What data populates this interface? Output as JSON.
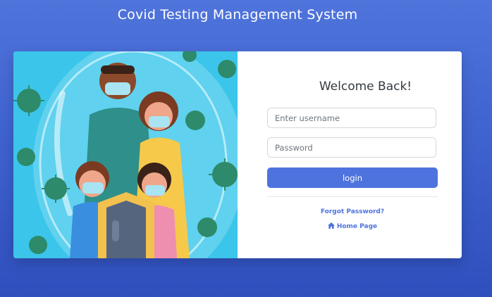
{
  "header": {
    "title": "Covid Testing Management System"
  },
  "login": {
    "heading": "Welcome Back!",
    "username_placeholder": "Enter username",
    "password_placeholder": "Password",
    "button_label": "login",
    "forgot_label": "Forgot Password?",
    "home_label": "Home Page",
    "home_icon": "home-icon"
  },
  "colors": {
    "accent": "#4e73df",
    "background_top": "#4f74db",
    "background_bottom": "#2f4fbd",
    "illustration_bg": "#3bc5ea"
  }
}
